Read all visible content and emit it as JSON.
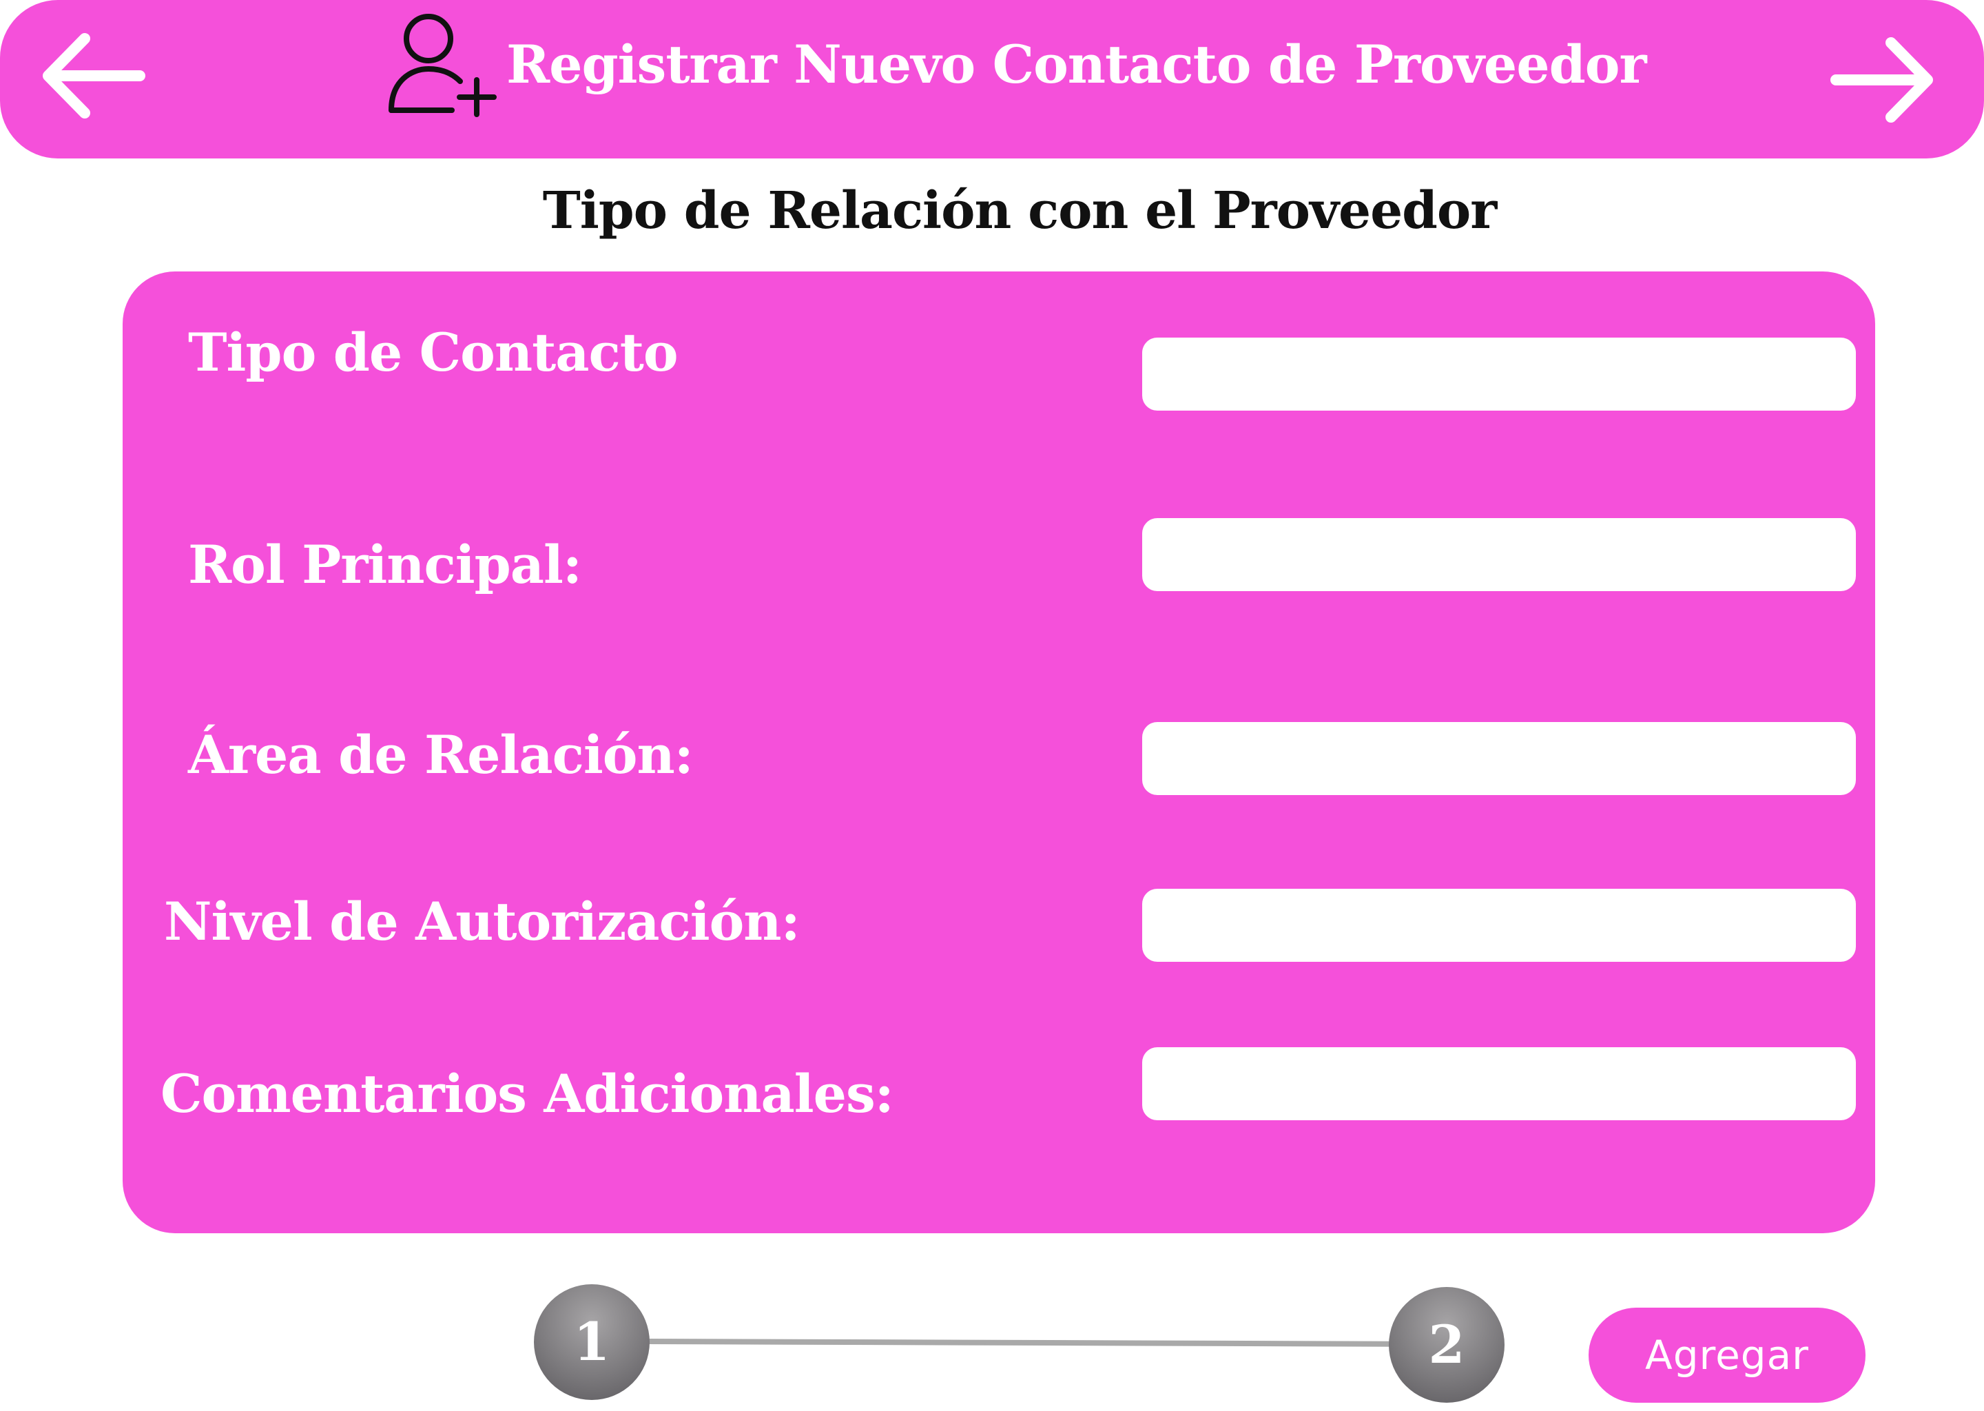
{
  "header": {
    "title": "Registrar Nuevo Contacto de Proveedor",
    "back_icon": "arrow-left-icon",
    "forward_icon": "arrow-right-icon",
    "user_icon": "user-add-icon",
    "background_color": "#f550da"
  },
  "section": {
    "title": "Tipo de Relación con el Proveedor"
  },
  "form": {
    "fields": [
      {
        "label": "Tipo de Contacto",
        "value": ""
      },
      {
        "label": "Rol Principal:",
        "value": ""
      },
      {
        "label": "Área de Relación:",
        "value": ""
      },
      {
        "label": "Nivel de Autorización:",
        "value": ""
      },
      {
        "label": "Comentarios Adicionales:",
        "value": ""
      }
    ]
  },
  "stepper": {
    "steps": [
      "1",
      "2"
    ],
    "color": "#7d7b7e"
  },
  "actions": {
    "add_label": "Agregar"
  },
  "colors": {
    "accent": "#f550da",
    "text_on_accent": "#ffffff",
    "heading": "#111111"
  }
}
